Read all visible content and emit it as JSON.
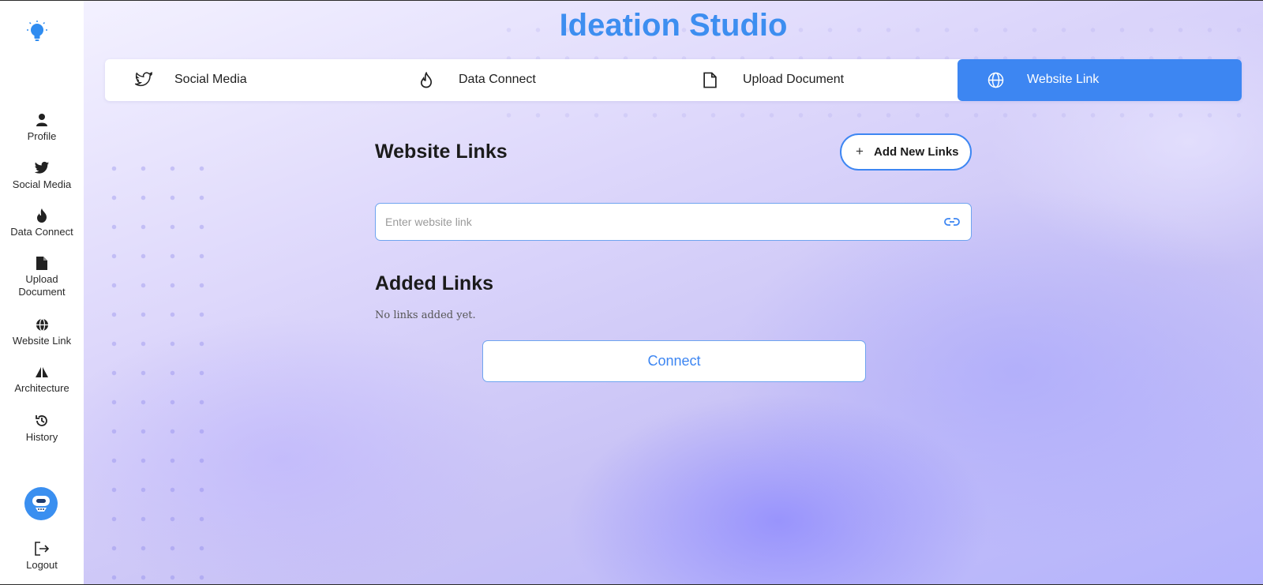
{
  "app": {
    "title": "Ideation Studio"
  },
  "colors": {
    "accent": "#3d86f2",
    "title": "#3d8ef0",
    "bot": "#3a8ff0"
  },
  "sidebar": {
    "items": [
      {
        "label": "Profile",
        "icon": "user-icon"
      },
      {
        "label": "Social Media",
        "icon": "twitter-icon"
      },
      {
        "label": "Data Connect",
        "icon": "flame-icon"
      },
      {
        "label": "Upload Document",
        "icon": "document-icon"
      },
      {
        "label": "Website Link",
        "icon": "globe-icon"
      },
      {
        "label": "Architecture",
        "icon": "architecture-icon"
      },
      {
        "label": "History",
        "icon": "history-icon"
      }
    ],
    "logout_label": "Logout"
  },
  "tabs": [
    {
      "label": "Social Media",
      "icon": "twitter-icon"
    },
    {
      "label": "Data Connect",
      "icon": "flame-icon"
    },
    {
      "label": "Upload Document",
      "icon": "document-icon"
    },
    {
      "label": "Website Link",
      "icon": "globe-icon",
      "active": true
    }
  ],
  "website_links": {
    "heading": "Website Links",
    "add_button_label": "Add New Links",
    "input_placeholder": "Enter website link",
    "input_value": ""
  },
  "added_links": {
    "heading": "Added Links",
    "empty_text": "No links added yet.",
    "items": []
  },
  "connect_label": "Connect"
}
